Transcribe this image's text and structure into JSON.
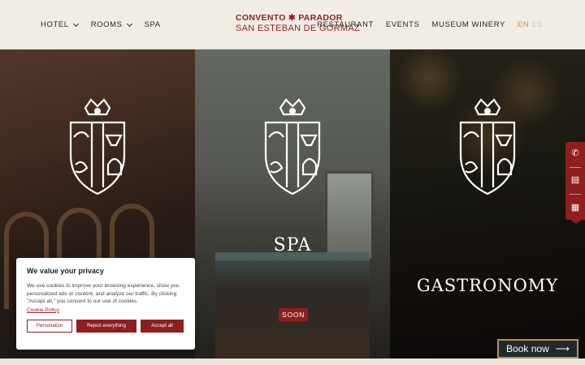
{
  "header": {
    "nav_left": [
      {
        "label": "HOTEL",
        "dropdown": true
      },
      {
        "label": "ROOMS",
        "dropdown": true
      },
      {
        "label": "SPA",
        "dropdown": false
      }
    ],
    "logo": {
      "line1": "CONVENTO ✱ PARADOR",
      "line2": "SAN ESTEBAN DE GORMAZ"
    },
    "nav_right": [
      {
        "label": "RESTAURANT"
      },
      {
        "label": "EVENTS"
      },
      {
        "label": "MUSEUM WINERY"
      }
    ],
    "lang": {
      "active": "EN",
      "inactive": "ES"
    }
  },
  "panels": [
    {
      "title": "",
      "badge": ""
    },
    {
      "title": "SPA",
      "badge": "SOON"
    },
    {
      "title": "GASTRONOMY",
      "badge": ""
    }
  ],
  "side_widget": {
    "icons": [
      "phone-icon",
      "reception-icon",
      "calendar-icon"
    ]
  },
  "cookie": {
    "title": "We value your privacy",
    "text": "We use cookies to improve your browsing experience, show you personalized ads or content, and analyze our traffic. By clicking \"Accept all,\" you consent to our use of cookies.",
    "policy_link": "Cookie Policy",
    "buttons": {
      "personalize": "Personalize",
      "reject": "Reject everything",
      "accept": "Accept all"
    }
  },
  "book": {
    "label": "Book now"
  },
  "colors": {
    "brand": "#8f1f1f",
    "gold": "#b8905a",
    "header_bg": "#f1ede5",
    "book_bg": "#1f2a2d"
  }
}
